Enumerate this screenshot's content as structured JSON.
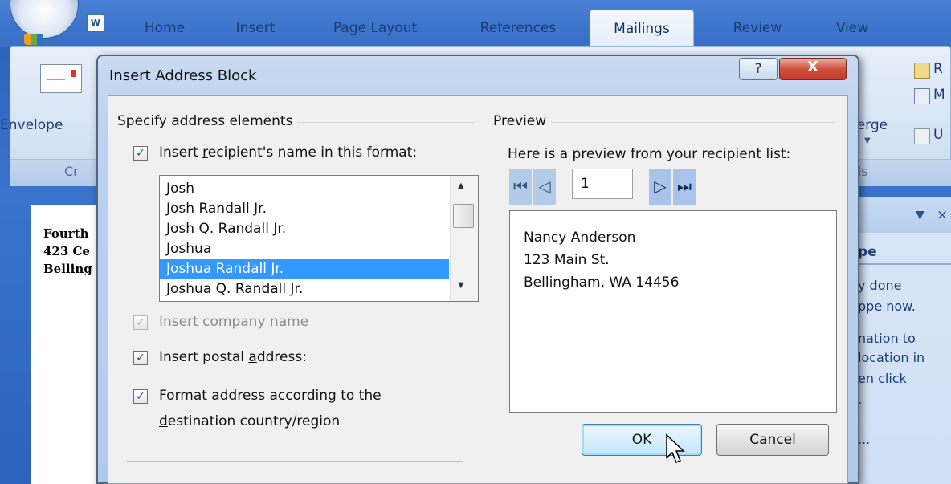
{
  "ribbon": {
    "tabs": [
      {
        "label": "Home"
      },
      {
        "label": "Insert"
      },
      {
        "label": "Page Layout"
      },
      {
        "label": "References"
      },
      {
        "label": "Mailings"
      },
      {
        "label": "Review"
      },
      {
        "label": "View"
      }
    ],
    "active_tab": "Mailings",
    "word_icon": "W",
    "envelopes_label": "Envelope",
    "create_group": "Cr",
    "merge_label": "lerge",
    "ds_group": "ds",
    "right_items": [
      "R",
      "M",
      "U"
    ]
  },
  "document": {
    "lines": [
      "Fourth",
      "423 Ce",
      "Belling"
    ]
  },
  "task_pane": {
    "title": "pe",
    "lines": [
      "y done",
      "ppe now.",
      "nation to",
      "location in",
      "en click",
      ".",
      "..."
    ]
  },
  "dialog": {
    "title": "Insert Address Block",
    "help_label": "?",
    "close_label": "X",
    "address_elements": {
      "group_label": "Specify address elements",
      "recipient_name": {
        "checked": true,
        "label_pre": "Insert ",
        "label_u": "r",
        "label_post": "ecipient's name in this format:"
      },
      "name_formats": [
        "Josh",
        "Josh Randall Jr.",
        "Josh Q. Randall Jr.",
        "Joshua",
        "Joshua Randall Jr.",
        "Joshua Q. Randall Jr."
      ],
      "selected_format": "Joshua Randall Jr.",
      "company_name": {
        "checked": true,
        "disabled": true,
        "label": "Insert company name"
      },
      "postal_address": {
        "checked": true,
        "label_pre": "Insert postal ",
        "label_u": "a",
        "label_post": "ddress:"
      },
      "format_address": {
        "checked": true,
        "line1": "Format address according to the",
        "line2_u": "d",
        "line2_post": "estination country/region"
      }
    },
    "preview": {
      "group_label": "Preview",
      "description": "Here is a preview from your recipient list:",
      "record": "1",
      "address_lines": [
        "Nancy  Anderson",
        "123 Main St.",
        "Bellingham, WA 14456"
      ]
    },
    "buttons": {
      "ok": "OK",
      "cancel": "Cancel"
    },
    "check_glyph": "✓"
  }
}
